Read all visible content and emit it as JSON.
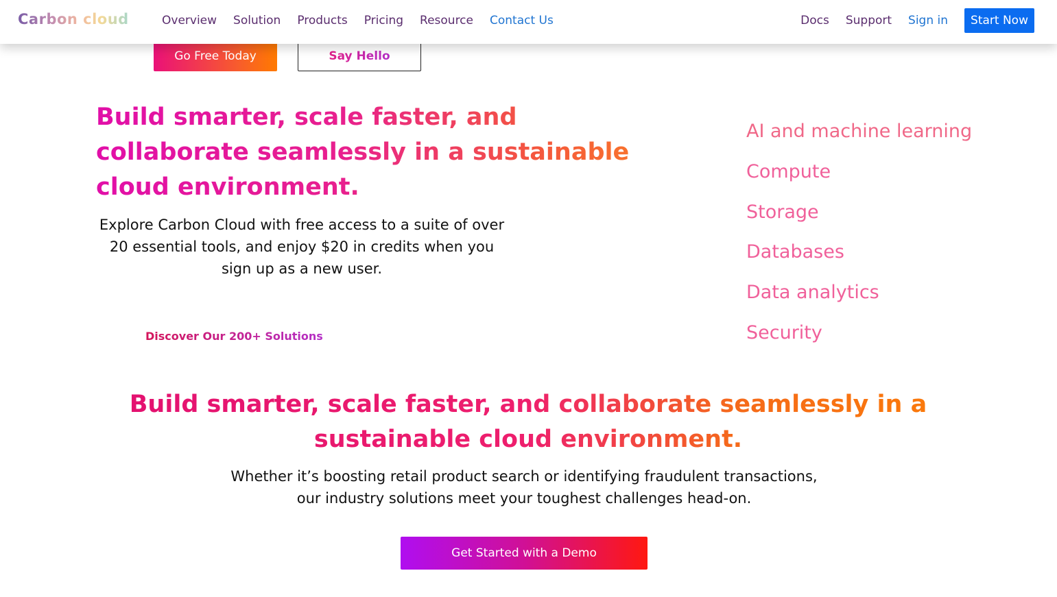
{
  "nav": {
    "brand": "Carbon cloud",
    "left_links": [
      "Overview",
      "Solution",
      "Products",
      "Pricing",
      "Resource",
      "Contact Us"
    ],
    "right_links": [
      "Docs",
      "Support",
      "Sign in"
    ],
    "start_label": "Start Now"
  },
  "hero": {
    "go_free_label": "Go Free Today",
    "say_hello_label": "Say Hello",
    "title": "Build smarter, scale faster, and collaborate seamlessly in a sustainable cloud environment.",
    "description": "Explore Carbon Cloud with free access to a suite of over 20 essential tools, and enjoy $20 in credits when you sign up as a new user.",
    "discover_label": "Discover Our 200+ Solutions"
  },
  "categories": [
    "AI and machine learning",
    "Compute",
    "Storage",
    "Databases",
    "Data analytics",
    "Security"
  ],
  "section": {
    "title": "Build smarter, scale faster, and collaborate seamlessly in a sustainable cloud environment.",
    "description": "Whether it’s boosting retail product search or identifying fraudulent transactions, our industry solutions meet your toughest challenges head-on.",
    "demo_label": "Get Started with a Demo"
  },
  "colors": {
    "primary_blue": "#0b6cf0",
    "nav_link": "#5a2d6e",
    "accent_pink": "#f0609a",
    "gradient_orange": "#ff7a00"
  }
}
